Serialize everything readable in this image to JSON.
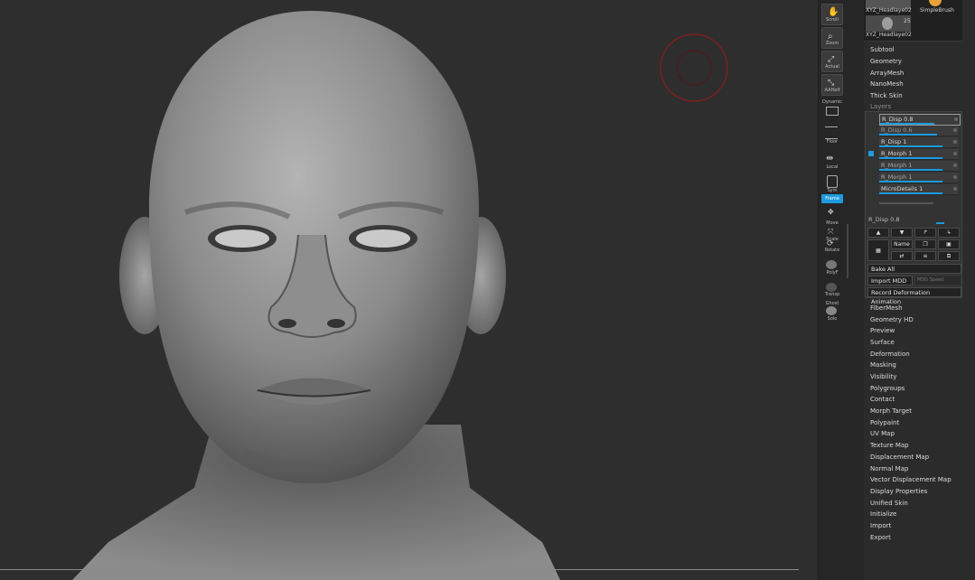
{
  "thumbnails": [
    {
      "label": "XYZ_Headlaye02"
    },
    {
      "label": "SimpleBrush"
    },
    {
      "label": "XYZ_Headlaye02",
      "badge": "25"
    }
  ],
  "tool_menu_top": [
    "Subtool",
    "Geometry",
    "ArrayMesh",
    "NanoMesh",
    "Thick Skin",
    "Layers"
  ],
  "layers": {
    "items": [
      {
        "name": "R_Disp 0.8"
      },
      {
        "name": "R_Disp 0.6"
      },
      {
        "name": "R_Disp 1"
      },
      {
        "name": "R_Morph 1"
      },
      {
        "name": "R_Morph 1"
      },
      {
        "name": "R_Morph 1"
      },
      {
        "name": "MicroDetails 1"
      }
    ],
    "current_label": "R_Disp 0.8",
    "name_button": "Name",
    "bake_all": "Bake All",
    "import_mdd": "Import MDD",
    "mdd_speed": "MDD Speed",
    "record_anim": "Record Deformation Animation"
  },
  "tool_menu_bottom": [
    "FiberMesh",
    "Geometry HD",
    "Preview",
    "Surface",
    "Deformation",
    "Masking",
    "Visibility",
    "Polygroups",
    "Contact",
    "Morph Target",
    "Polypaint",
    "UV Map",
    "Texture Map",
    "Displacement Map",
    "Normal Map",
    "Vector Displacement Map",
    "Display Properties",
    "Unified Skin",
    "Initialize",
    "Import",
    "Export"
  ],
  "shelf": [
    {
      "label": "Scroll",
      "icon": "hand-icon"
    },
    {
      "label": "Zoom",
      "icon": "zoom-icon"
    },
    {
      "label": "Actual",
      "icon": "actual-icon"
    },
    {
      "label": "AAHalf",
      "icon": "aahalf-icon"
    },
    {
      "label": "Dynamic",
      "icon": "persp-icon"
    },
    {
      "label": "Floor",
      "icon": "floor-icon"
    },
    {
      "label": "Local",
      "icon": "local-icon"
    },
    {
      "label": "Sym",
      "icon": "sym-icon"
    },
    {
      "label": "Frame",
      "icon": "frame-icon"
    },
    {
      "label": "Move",
      "icon": "move-icon"
    },
    {
      "label": "Scale",
      "icon": "scale-icon"
    },
    {
      "label": "Rotate",
      "icon": "rotate-icon"
    },
    {
      "label": "PolyF",
      "icon": "polyf-icon"
    },
    {
      "label": "Transp",
      "icon": "transp-icon"
    },
    {
      "label": "Ghost",
      "icon": "ghost-icon"
    },
    {
      "label": "Solo",
      "icon": "solo-icon"
    }
  ],
  "colors": {
    "accent": "#1c9be0",
    "brush_ring": "#a01818"
  }
}
